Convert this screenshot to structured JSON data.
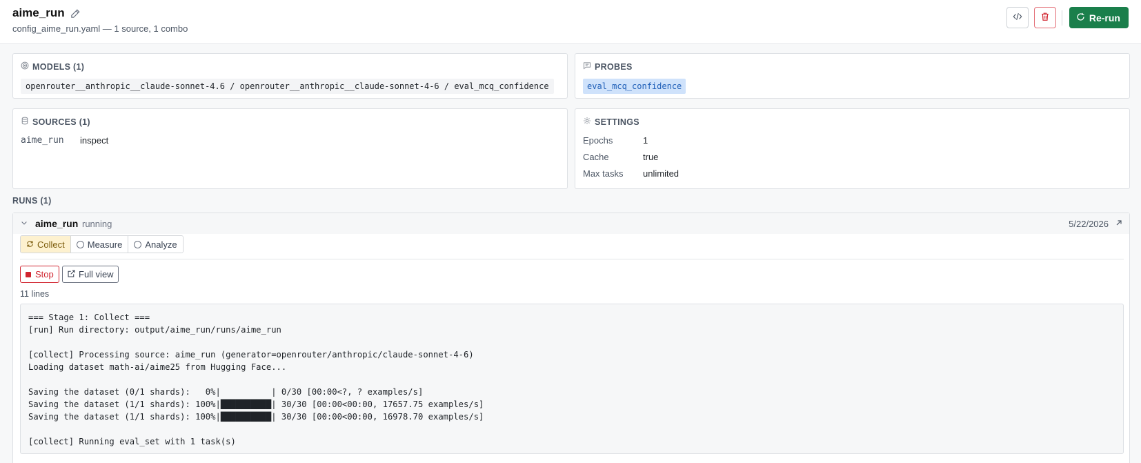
{
  "header": {
    "title": "aime_run",
    "subtitle": "config_aime_run.yaml — 1 source, 1 combo",
    "rerun_label": "Re-run"
  },
  "models": {
    "heading": "MODELS (1)",
    "value": "openrouter__anthropic__claude-sonnet-4.6 / openrouter__anthropic__claude-sonnet-4-6 / eval_mcq_confidence"
  },
  "probes": {
    "heading": "PROBES",
    "chip": "eval_mcq_confidence"
  },
  "sources": {
    "heading": "SOURCES (1)",
    "items": [
      {
        "name": "aime_run",
        "type": "inspect"
      }
    ]
  },
  "settings": {
    "heading": "SETTINGS",
    "rows": [
      {
        "key": "Epochs",
        "value": "1"
      },
      {
        "key": "Cache",
        "value": "true"
      },
      {
        "key": "Max tasks",
        "value": "unlimited"
      }
    ]
  },
  "runs": {
    "heading": "RUNS (1)",
    "items": [
      {
        "name": "aime_run",
        "status": "running",
        "date": "5/22/2026",
        "tabs": [
          {
            "label": "Collect",
            "active": true,
            "icon": "refresh-icon"
          },
          {
            "label": "Measure",
            "active": false,
            "icon": "radio-icon"
          },
          {
            "label": "Analyze",
            "active": false,
            "icon": "radio-icon"
          }
        ],
        "stop_label": "Stop",
        "full_view_label": "Full view",
        "lines_count": "11 lines",
        "log": [
          "=== Stage 1: Collect ===",
          "[run] Run directory: output/aime_run/runs/aime_run",
          "",
          "[collect] Processing source: aime_run (generator=openrouter/anthropic/claude-sonnet-4-6)",
          "Loading dataset math-ai/aime25 from Hugging Face...",
          "",
          "Saving the dataset (0/1 shards):   0%|          | 0/30 [00:00<?, ? examples/s]",
          "Saving the dataset (1/1 shards): 100%|██████████| 30/30 [00:00<00:00, 17657.75 examples/s]",
          "Saving the dataset (1/1 shards): 100%|██████████| 30/30 [00:00<00:00, 16978.70 examples/s]",
          "",
          "[collect] Running eval_set with 1 task(s)"
        ]
      }
    ]
  },
  "colors": {
    "accent_green": "#1a7f4b",
    "danger_red": "#d1242f",
    "probe_chip_bg": "#cfe2fb",
    "active_tab_bg": "#fdf1cf"
  }
}
